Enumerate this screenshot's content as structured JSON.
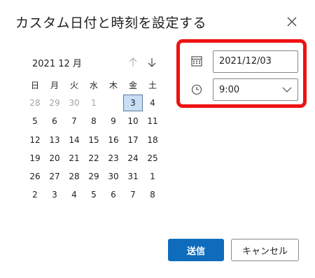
{
  "dialog": {
    "title": "カスタム日付と時刻を設定する"
  },
  "calendar": {
    "month_label": "2021 12 月",
    "weekdays": [
      "日",
      "月",
      "火",
      "水",
      "木",
      "金",
      "土"
    ],
    "weeks": [
      [
        {
          "d": "28",
          "dim": true
        },
        {
          "d": "29",
          "dim": true
        },
        {
          "d": "30",
          "dim": true
        },
        {
          "d": "1",
          "dim": true
        },
        {
          "d": "2",
          "today": true
        },
        {
          "d": "3",
          "selected": true
        },
        {
          "d": "4"
        }
      ],
      [
        {
          "d": "5"
        },
        {
          "d": "6"
        },
        {
          "d": "7"
        },
        {
          "d": "8"
        },
        {
          "d": "9"
        },
        {
          "d": "10"
        },
        {
          "d": "11"
        }
      ],
      [
        {
          "d": "12"
        },
        {
          "d": "13"
        },
        {
          "d": "14"
        },
        {
          "d": "15"
        },
        {
          "d": "16"
        },
        {
          "d": "17"
        },
        {
          "d": "18"
        }
      ],
      [
        {
          "d": "19"
        },
        {
          "d": "20"
        },
        {
          "d": "21"
        },
        {
          "d": "22"
        },
        {
          "d": "23"
        },
        {
          "d": "24"
        },
        {
          "d": "25"
        }
      ],
      [
        {
          "d": "26"
        },
        {
          "d": "27"
        },
        {
          "d": "28"
        },
        {
          "d": "29"
        },
        {
          "d": "30"
        },
        {
          "d": "31"
        },
        {
          "d": "1"
        }
      ],
      [
        {
          "d": "2"
        },
        {
          "d": "3"
        },
        {
          "d": "4"
        },
        {
          "d": "5"
        },
        {
          "d": "6"
        },
        {
          "d": "7"
        },
        {
          "d": "8"
        }
      ]
    ]
  },
  "fields": {
    "date_value": "2021/12/03",
    "time_value": "9:00"
  },
  "buttons": {
    "send_label": "送信",
    "cancel_label": "キャンセル"
  },
  "colors": {
    "accent": "#0f6cbd",
    "highlight": "#ee1111",
    "selected_bg": "#c7def5"
  }
}
